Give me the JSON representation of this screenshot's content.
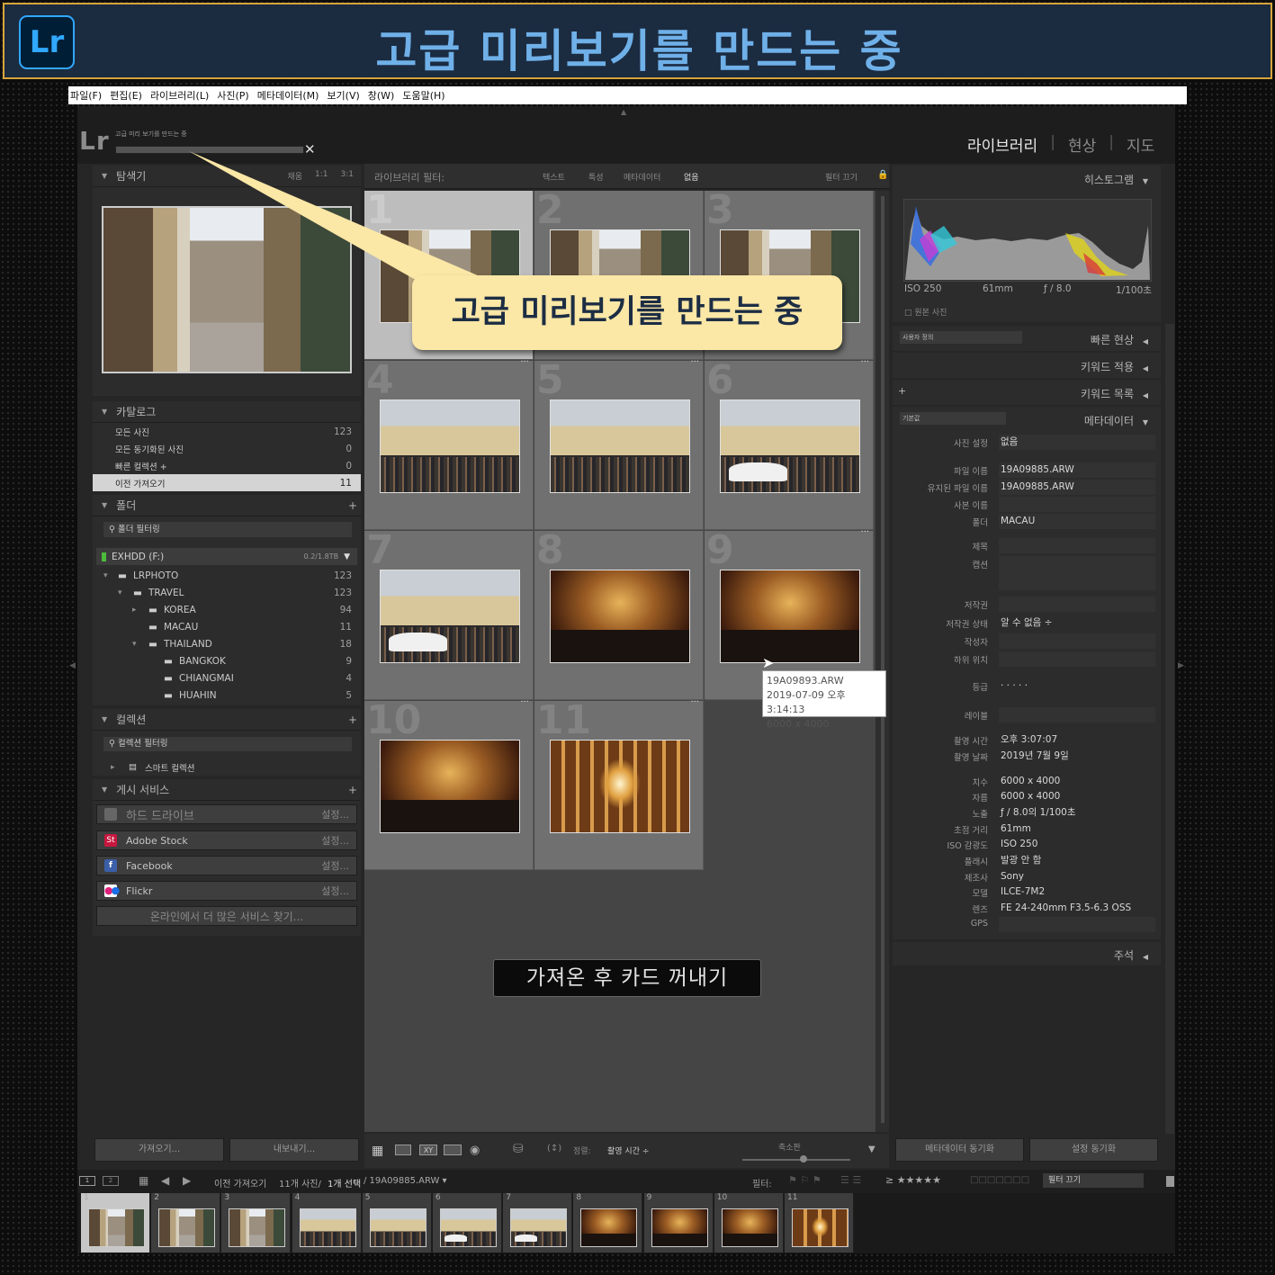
{
  "banner": {
    "logo": "Lr",
    "title": "고급 미리보기를 만드는 중"
  },
  "menu": [
    "파일(F)",
    "편집(E)",
    "라이브러리(L)",
    "사진(P)",
    "메타데이터(M)",
    "보기(V)",
    "창(W)",
    "도움말(H)"
  ],
  "app": {
    "logo": "Lr",
    "progress_label": "고급 미리 보기를 만드는 중",
    "cancel": "✕",
    "modules": [
      "라이브러리",
      "현상",
      "지도"
    ],
    "module_sep": "|"
  },
  "navigator": {
    "title": "탐색기",
    "zoom": [
      "채움",
      "1:1",
      "3:1"
    ]
  },
  "catalog": {
    "title": "카탈로그",
    "items": [
      {
        "label": "모든 사진",
        "count": "123"
      },
      {
        "label": "모든 동기화된 사진",
        "count": "0"
      },
      {
        "label": "빠른 컬렉션 +",
        "count": "0"
      },
      {
        "label": "이전 가져오기",
        "count": "11"
      }
    ]
  },
  "folders": {
    "title": "폴더",
    "add": "+",
    "filter": "폴더 필터링",
    "volume": "EXHDD (F:)",
    "volume_size": "0.2/1.8TB",
    "tree": [
      {
        "label": "LRPHOTO",
        "count": "123"
      },
      {
        "label": "TRAVEL",
        "count": "123"
      },
      {
        "label": "KOREA",
        "count": "94"
      },
      {
        "label": "MACAU",
        "count": "11"
      },
      {
        "label": "THAILAND",
        "count": "18"
      },
      {
        "label": "BANGKOK",
        "count": "9"
      },
      {
        "label": "CHIANGMAI",
        "count": "4"
      },
      {
        "label": "HUAHIN",
        "count": "5"
      }
    ]
  },
  "collections": {
    "title": "컬렉션",
    "add": "+",
    "filter": "컬렉션 필터링",
    "smart": "스마트 컬렉션"
  },
  "publish": {
    "title": "게시 서비스",
    "add": "+",
    "services": [
      {
        "label": "하드 드라이브",
        "action": "설정..."
      },
      {
        "label": "Adobe Stock",
        "action": "설정..."
      },
      {
        "label": "Facebook",
        "action": "설정..."
      },
      {
        "label": "Flickr",
        "action": "설정..."
      }
    ],
    "more": "온라인에서 더 많은 서비스 찾기..."
  },
  "left_buttons": {
    "import": "가져오기...",
    "export": "내보내기..."
  },
  "filterbar": {
    "label": "라이브러리 필터:",
    "tabs": [
      "텍스트",
      "특성",
      "메타데이터",
      "없음"
    ],
    "off": "필터 끄기"
  },
  "grid": {
    "cells": [
      "1",
      "2",
      "3",
      "4",
      "5",
      "6",
      "7",
      "8",
      "9",
      "10",
      "11"
    ],
    "hover_name": "19A09893.ARW",
    "hover_date": "2019-07-09 오후 3:14:13",
    "hover_dims": "6000 x 4000"
  },
  "callout": "고급 미리보기를 만드는 중",
  "eject": "가져온 후 카드 꺼내기",
  "histogram": {
    "title": "히스토그램",
    "iso": "ISO 250",
    "focal": "61mm",
    "aperture": "ƒ / 8.0",
    "shutter": "1/100초",
    "original": "원본 사진"
  },
  "quick_develop": {
    "preset": "사용자 정의",
    "title": "빠른 현상"
  },
  "keywording": {
    "title": "키워드 적용"
  },
  "keyword_list": {
    "title": "키워드 목록",
    "add": "+"
  },
  "metadata": {
    "preset": "기본값",
    "title": "메타데이터",
    "rows": [
      {
        "label": "사진 설정",
        "value": "없음"
      },
      {
        "label": "파일 이름",
        "value": "19A09885.ARW"
      },
      {
        "label": "유지된 파일 이름",
        "value": "19A09885.ARW"
      },
      {
        "label": "사본 이름",
        "value": ""
      },
      {
        "label": "폴더",
        "value": "MACAU"
      },
      {
        "label": "제목",
        "value": ""
      },
      {
        "label": "캡션",
        "value": ""
      },
      {
        "label": "저작권",
        "value": ""
      },
      {
        "label": "저작권 상태",
        "value": "알 수 없음 ÷"
      },
      {
        "label": "작성자",
        "value": ""
      },
      {
        "label": "하위 위치",
        "value": ""
      },
      {
        "label": "등급",
        "value": "· · · · ·"
      },
      {
        "label": "레이블",
        "value": ""
      },
      {
        "label": "촬영 시간",
        "value": "오후 3:07:07"
      },
      {
        "label": "촬영 날짜",
        "value": "2019년 7월 9일"
      },
      {
        "label": "치수",
        "value": "6000 x 4000"
      },
      {
        "label": "자름",
        "value": "6000 x 4000"
      },
      {
        "label": "노출",
        "value": "ƒ / 8.0의 1/100초"
      },
      {
        "label": "초점 거리",
        "value": "61mm"
      },
      {
        "label": "ISO 감광도",
        "value": "ISO 250"
      },
      {
        "label": "플래시",
        "value": "발광 안 함"
      },
      {
        "label": "제조사",
        "value": "Sony"
      },
      {
        "label": "모델",
        "value": "ILCE-7M2"
      },
      {
        "label": "렌즈",
        "value": "FE 24-240mm F3.5-6.3 OSS"
      },
      {
        "label": "GPS",
        "value": ""
      }
    ]
  },
  "comments": {
    "title": "주석"
  },
  "right_buttons": {
    "sync_meta": "메타데이터 동기화",
    "sync_settings": "설정 동기화"
  },
  "toolbar": {
    "sort_label": "정렬:",
    "sort_value": "촬영 시간 ÷",
    "thumb_label": "축소판"
  },
  "status": {
    "source": "이전 가져오기",
    "count": "11개 사진/",
    "selected": "1개 선택",
    "file": "/ 19A09885.ARW ▾",
    "filter_label": "필터:",
    "filter_value": "필터 끄기"
  },
  "filmstrip": [
    "1",
    "2",
    "3",
    "4",
    "5",
    "6",
    "7",
    "8",
    "9",
    "10",
    "11"
  ]
}
